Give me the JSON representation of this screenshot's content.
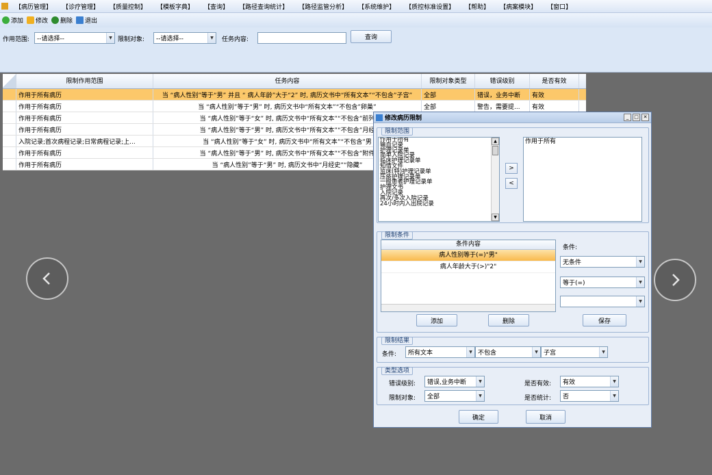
{
  "menu": [
    "【病历管理】",
    "【诊疗管理】",
    "【质量控制】",
    "【模板字典】",
    "【查询】",
    "【路径查询统计】",
    "【路径监管分析】",
    "【系统维护】",
    "【质控标准设置】",
    "【帮助】",
    "【病案模块】",
    "【窗口】"
  ],
  "toolbar": {
    "add": "添加",
    "edit": "修改",
    "delete": "删除",
    "exit": "退出"
  },
  "filter": {
    "scope_label": "作用范围:",
    "scope_value": "--请选择--",
    "target_label": "限制对象:",
    "target_value": "--请选择--",
    "task_label": "任务内容:",
    "task_value": "",
    "query_label": "查询"
  },
  "grid": {
    "headers": [
      "限制作用范围",
      "任务内容",
      "限制对象类型",
      "错误级别",
      "是否有效"
    ],
    "rows": [
      [
        "作用于所有病历",
        "当 “病人性别”等于“男”  并且 “ 病人年龄”大于“2” 时, 病历文书中“所有文本”“不包含”子宫”",
        "全部",
        "错误，业务中断",
        "有效"
      ],
      [
        "作用于所有病历",
        "当 “病人性别”等于“男” 时, 病历文书中“所有文本”“不包含”卵巢”",
        "全部",
        "警告，需要提...",
        "有效"
      ],
      [
        "作用于所有病历",
        "当 “病人性别”等于“女” 时, 病历文书中“所有文本”“不包含”前列",
        "",
        "",
        ""
      ],
      [
        "作用于所有病历",
        "当 “病人性别”等于“男” 时, 病历文书中“所有文本”“不包含”月经",
        "",
        "",
        ""
      ],
      [
        "入院记录;首次病程记录;日常病程记录;上...",
        "当 “病人性别”等于“女” 时, 病历文书中“所有文本”“不包含”男",
        "",
        "",
        ""
      ],
      [
        "作用于所有病历",
        "当 “病人性别”等于“男” 时, 病历文书中“所有文本”“不包含”附件",
        "",
        "",
        ""
      ],
      [
        "作用于所有病历",
        "当 “病人性别”等于“男” 时, 病历文书中“月经史”“隐藏”",
        "",
        "",
        ""
      ]
    ]
  },
  "dialog": {
    "title": "修改病历限制",
    "scope_group": "限制范围",
    "scope_items": [
      "作用于所有",
      "输血记录",
      "护理记录单",
      "简单入院记录",
      "临床护理记录单",
      "知情文件",
      "监床(特)护理记录单",
      "压疮护理记录单",
      "一般患者护理记录单",
      "护理文书",
      "入院记录",
      "再次/多次入院记录",
      "24小时内入出院记录"
    ],
    "selected_items": [
      "作用于所有"
    ],
    "move_right": ">",
    "move_left": "<",
    "cond_group": "限制条件",
    "cond_header": "条件内容",
    "cond_rows": [
      "病人性别等于(=)\"男\"",
      "病人年龄大于(>)\"2\""
    ],
    "cond_label": "条件:",
    "cond_combo1": "无条件",
    "cond_combo2": "等于(=)",
    "cond_combo3": "",
    "btn_add": "添加",
    "btn_delete": "删除",
    "btn_save": "保存",
    "result_group": "限制结果",
    "result_label": "条件:",
    "result_combo1": "所有文本",
    "result_combo2": "不包含",
    "result_combo3": "子宫",
    "type_group": "类型选项",
    "err_label": "错误级别:",
    "err_value": "错误,业务中断",
    "target_label": "限制对象:",
    "target_value": "全部",
    "valid_label": "是否有效:",
    "valid_value": "有效",
    "stat_label": "是否统计:",
    "stat_value": "否",
    "ok": "确定",
    "cancel": "取消"
  }
}
